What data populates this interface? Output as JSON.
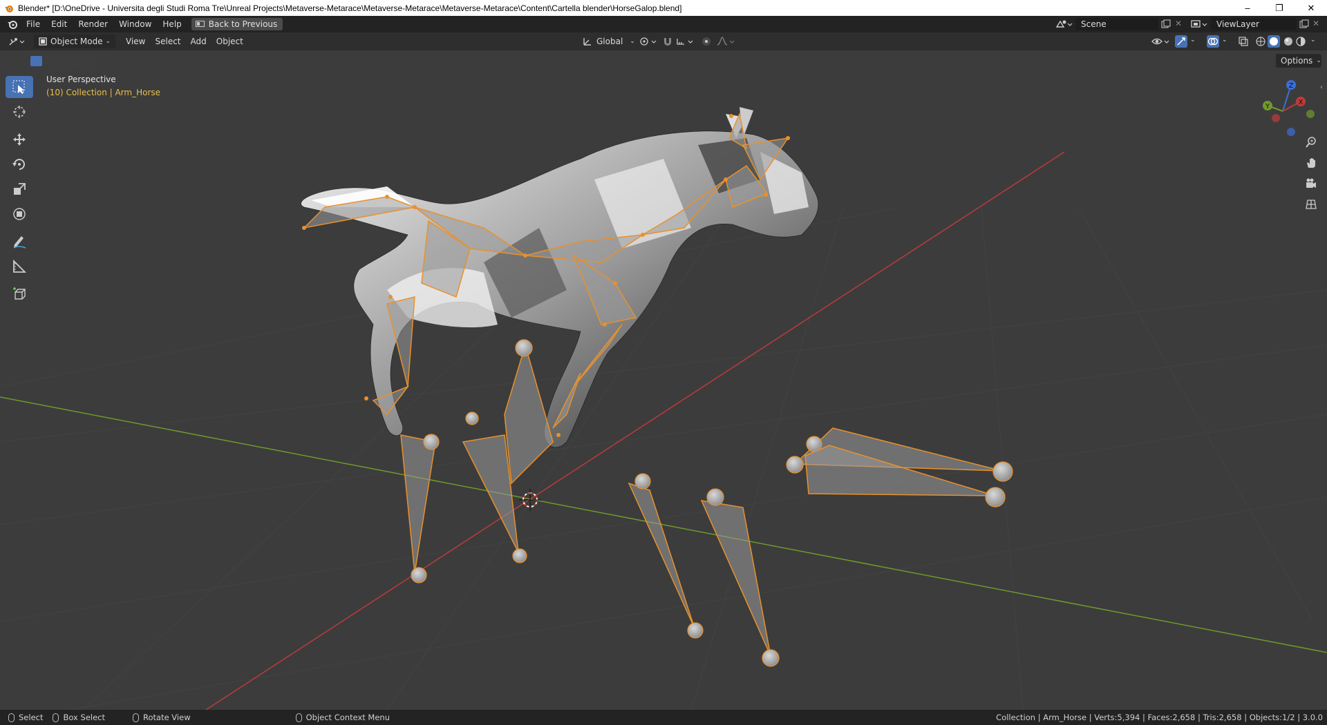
{
  "titlebar": {
    "title": "Blender* [D:\\OneDrive - Universita degli Studi Roma Tre\\Unreal Projects\\Metaverse-Metarace\\Metaverse-Metarace\\Metaverse-Metarace\\Content\\Cartella blender\\HorseGalop.blend]",
    "minimize": "–",
    "restore": "❐",
    "close": "✕"
  },
  "menubar": {
    "items": [
      "File",
      "Edit",
      "Render",
      "Window",
      "Help"
    ],
    "back_label": "Back to Previous",
    "scene_value": "Scene",
    "viewlayer_value": "ViewLayer"
  },
  "viewport_header": {
    "mode": "Object Mode",
    "menus": [
      "View",
      "Select",
      "Add",
      "Object"
    ],
    "orientation": "Global",
    "options_label": "Options"
  },
  "viewport": {
    "perspective_label": "User Perspective",
    "collection_label": "(10) Collection | Arm_Horse",
    "axis_x": "X",
    "axis_y": "Y",
    "axis_z": "Z"
  },
  "toolbar": {
    "tools": [
      "select-box-icon",
      "cursor-icon",
      "move-icon",
      "rotate-icon",
      "scale-icon",
      "transform-icon",
      "annotate-icon",
      "measure-icon",
      "add-cube-icon"
    ]
  },
  "statusbar": {
    "select": "Select",
    "box_select": "Box Select",
    "rotate_view": "Rotate View",
    "context_menu": "Object Context Menu",
    "stats": "Collection | Arm_Horse | Verts:5,394 | Faces:2,658 | Tris:2,658 | Objects:1/2 | 3.0.0"
  },
  "colors": {
    "accent": "#4772b3",
    "selection": "#e8912c",
    "axis_x": "#c03a3a",
    "axis_y": "#6f9a2c",
    "axis_z": "#3b6fd6"
  }
}
